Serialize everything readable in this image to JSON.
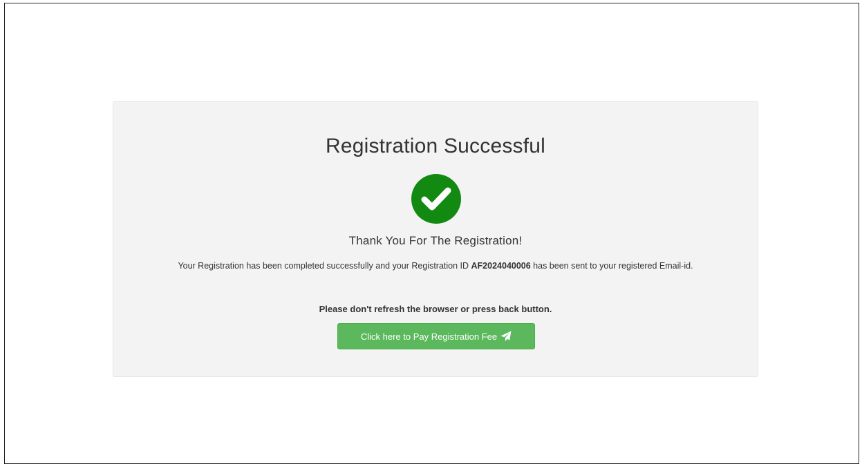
{
  "panel": {
    "title": "Registration Successful",
    "check_icon": "check-circle-icon",
    "thanks": "Thank You For The Registration!",
    "message_before": "Your Registration has been completed successfully and your Registration ID ",
    "registration_id": "AF2024040006",
    "message_after": " has been sent to your registered Email-id.",
    "warning": "Please don't refresh the browser or press back button.",
    "pay_button_label": "Click here to Pay Registration Fee",
    "pay_button_icon": "paper-plane-icon"
  },
  "colors": {
    "success_green": "#128a12",
    "button_green": "#5cb85c",
    "panel_background": "#f3f3f3"
  }
}
